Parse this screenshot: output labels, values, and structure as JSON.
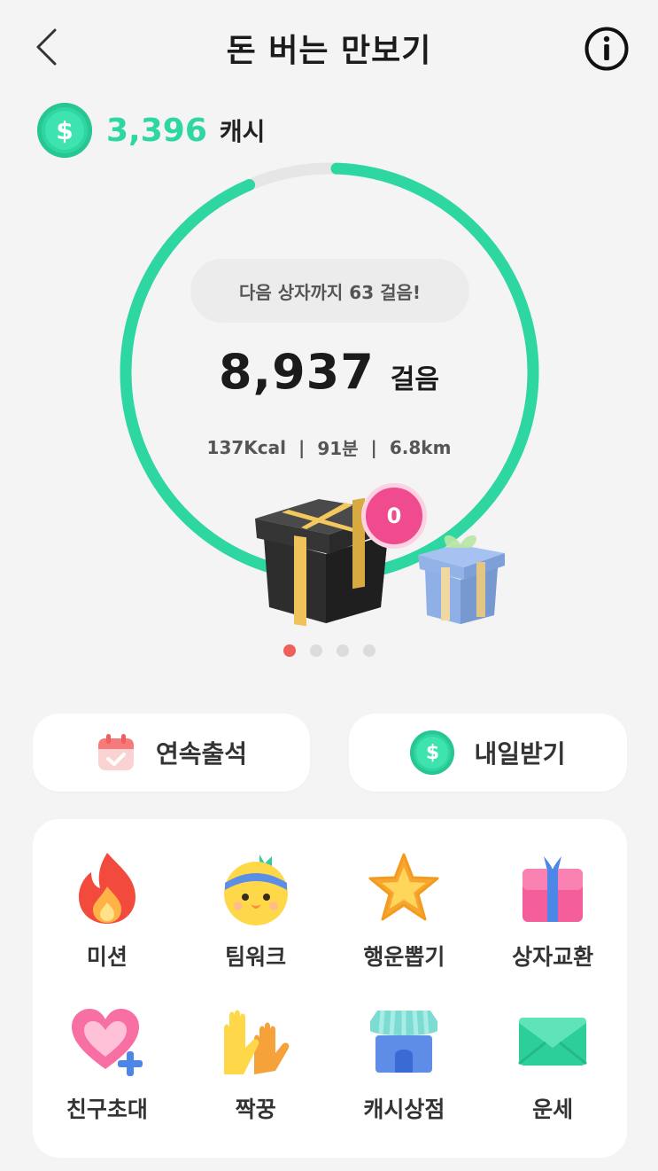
{
  "header": {
    "title": "돈 버는 만보기",
    "back_icon": "chevron-left-icon",
    "info_icon": "info-icon"
  },
  "cash": {
    "icon": "dollar-coin-icon",
    "amount": "3,396",
    "unit": "캐시"
  },
  "progress": {
    "fraction": 0.93,
    "color": "#2ed7a2",
    "track_color": "#e6e6e6"
  },
  "next_box": {
    "text": "다음 상자까지 63 걸음!"
  },
  "steps": {
    "value": "8,937",
    "unit": "걸음"
  },
  "stats": {
    "kcal": "137Kcal",
    "minutes": "91분",
    "distance": "6.8km",
    "separator": "|"
  },
  "gift": {
    "badge_count": "0",
    "icons": [
      "black-gift-box-icon",
      "blue-gift-box-icon"
    ]
  },
  "carousel": {
    "total": 4,
    "active": 0
  },
  "buttons": {
    "attendance": {
      "label": "연속출석",
      "icon": "calendar-check-icon"
    },
    "tomorrow": {
      "label": "내일받기",
      "icon": "dollar-coin-icon"
    }
  },
  "menu": [
    {
      "label": "미션",
      "icon": "fire-icon"
    },
    {
      "label": "팀워크",
      "icon": "chick-headband-icon"
    },
    {
      "label": "행운뽑기",
      "icon": "star-icon"
    },
    {
      "label": "상자교환",
      "icon": "gift-box-icon"
    },
    {
      "label": "친구초대",
      "icon": "heart-plus-icon"
    },
    {
      "label": "짝꿍",
      "icon": "gloves-icon"
    },
    {
      "label": "캐시상점",
      "icon": "store-icon"
    },
    {
      "label": "운세",
      "icon": "envelope-icon"
    }
  ]
}
